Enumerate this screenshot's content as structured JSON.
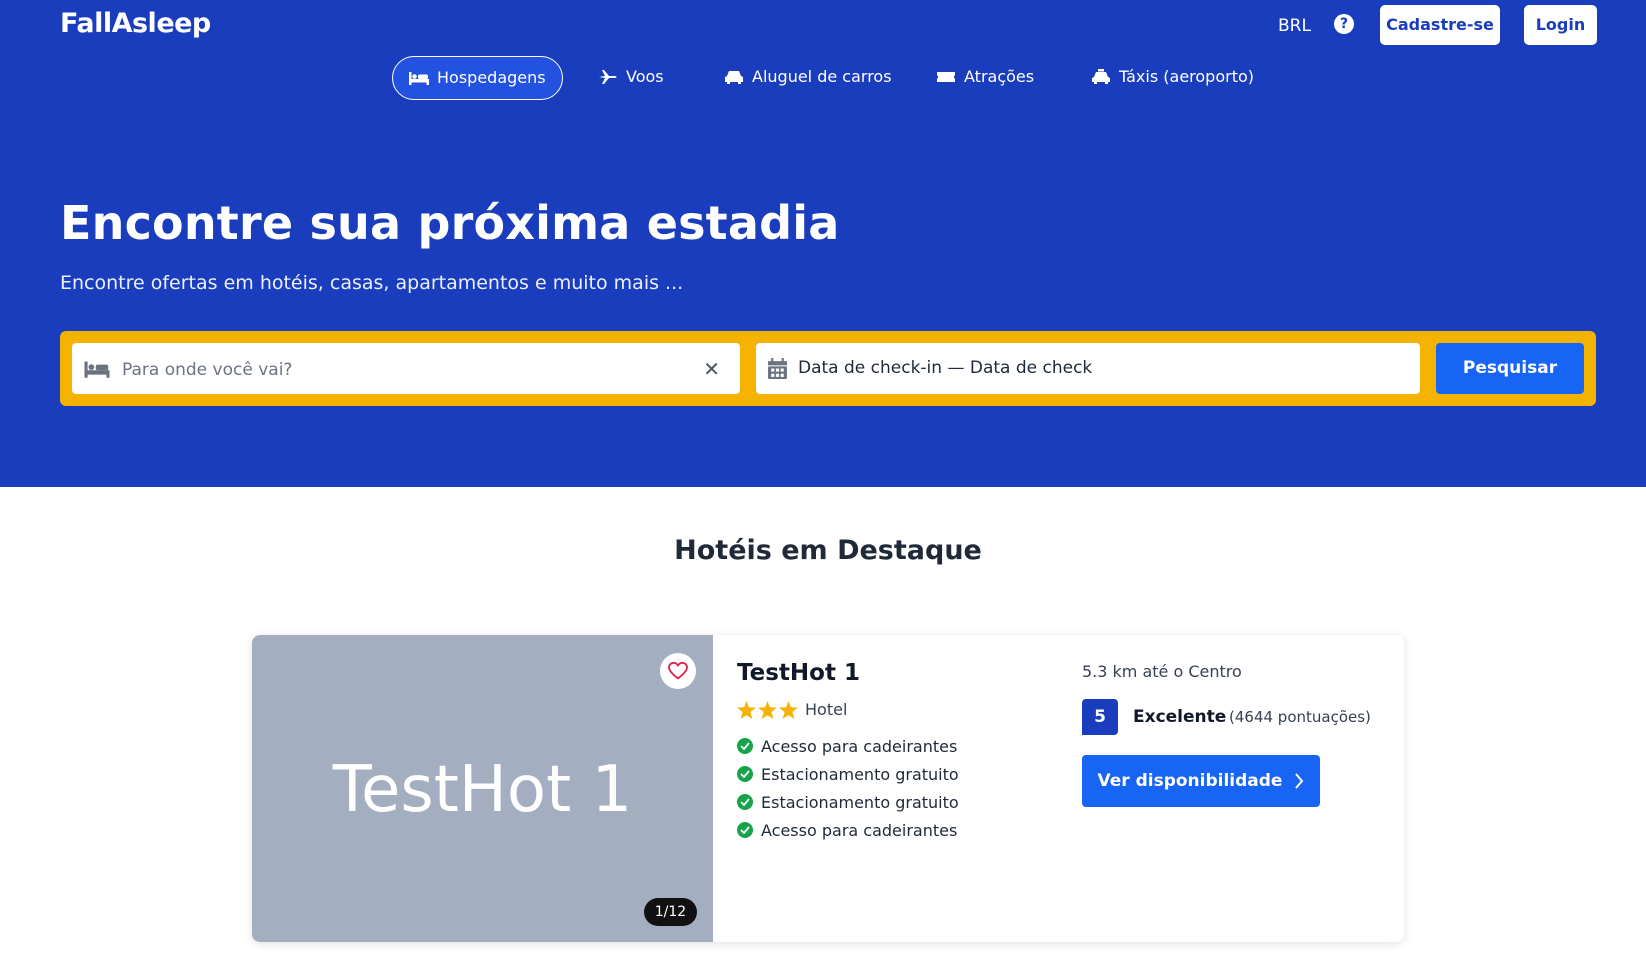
{
  "header": {
    "logo": "FallAsleep",
    "currency": "BRL",
    "help_icon": "?",
    "signup_label": "Cadastre-se",
    "login_label": "Login"
  },
  "nav": {
    "tabs": [
      {
        "label": "Hospedagens",
        "icon": "bed-icon",
        "active": true
      },
      {
        "label": "Voos",
        "icon": "plane-icon"
      },
      {
        "label": "Aluguel de carros",
        "icon": "car-icon"
      },
      {
        "label": "Atrações",
        "icon": "ticket-icon"
      },
      {
        "label": "Táxis (aeroporto)",
        "icon": "taxi-icon"
      }
    ]
  },
  "hero": {
    "title": "Encontre sua próxima estadia",
    "subtitle": "Encontre ofertas em hotéis, casas, apartamentos e muito mais ..."
  },
  "search": {
    "destination_placeholder": "Para onde você vai?",
    "destination_value": "",
    "dates_text": "Data de check-in — Data de check",
    "search_label": "Pesquisar"
  },
  "featured": {
    "title": "Hotéis em Destaque",
    "hotels": [
      {
        "image_text": "TestHot 1",
        "image_counter": "1/12",
        "name": "TestHot 1",
        "stars": 3,
        "type": "Hotel",
        "amenities": [
          "Acesso para cadeirantes",
          "Estacionamento gratuito",
          "Estacionamento gratuito",
          "Acesso para cadeirantes"
        ],
        "distance": "5.3 km até o Centro",
        "score": "5",
        "rating_label": "Excelente",
        "reviews": "(4644 pontuações)",
        "cta_label": "Ver disponibilidade"
      }
    ]
  },
  "colors": {
    "brand_blue": "#1a3dbe",
    "accent_blue": "#1764f5",
    "search_yellow": "#f5b301",
    "star_yellow": "#f5b301",
    "check_green": "#16a34a",
    "heart_red": "#e11d48"
  }
}
